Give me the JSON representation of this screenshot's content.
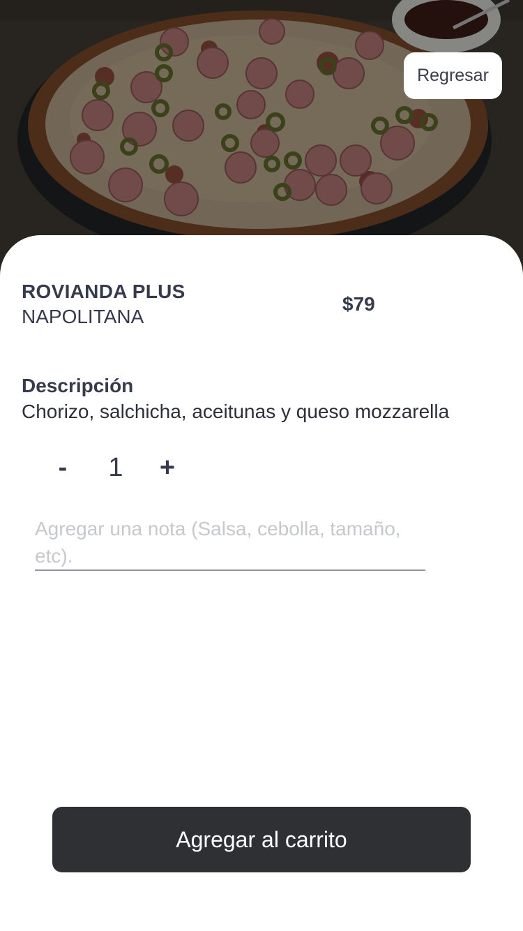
{
  "header": {
    "back_label": "Regresar"
  },
  "product": {
    "name": "ROVIANDA PLUS",
    "category": "NAPOLITANA",
    "price": "$79"
  },
  "description": {
    "title": "Descripción",
    "text": "Chorizo, salchicha, aceitunas y queso mozzarella"
  },
  "quantity": {
    "minus_label": "-",
    "value": "1",
    "plus_label": "+"
  },
  "note": {
    "placeholder": "Agregar una nota (Salsa, cebolla, tamaño, etc).",
    "value": ""
  },
  "footer": {
    "add_to_cart_label": "Agregar al carrito"
  },
  "colors": {
    "text_primary": "#363a4d",
    "button_dark": "#2f3034",
    "placeholder": "#c6c8cc",
    "background": "#ffffff"
  }
}
